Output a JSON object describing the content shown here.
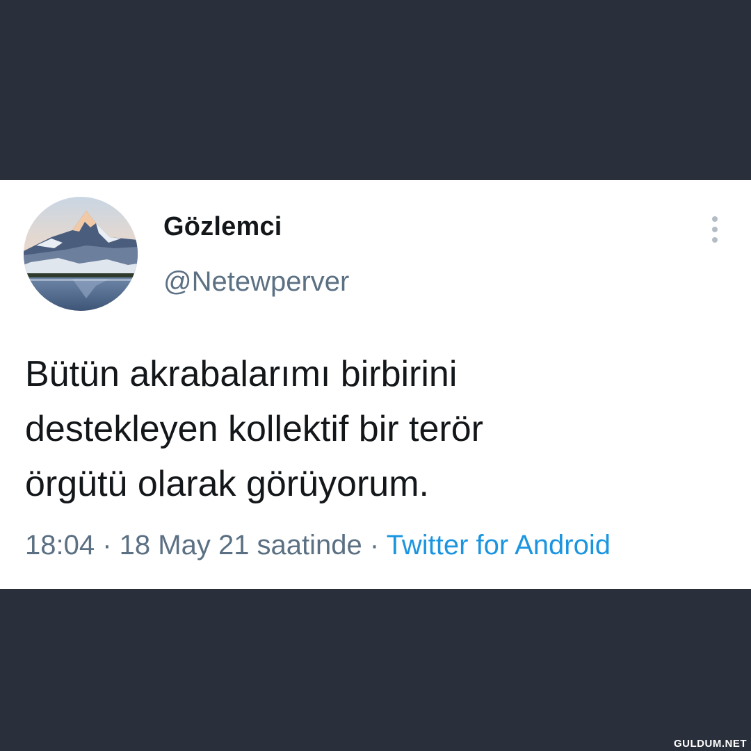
{
  "tweet": {
    "display_name": "Gözlemci",
    "handle": "@Netewperver",
    "text": "Bütün akrabalarımı birbirini\ndestekleyen kollektif bir terör\nörgütü olarak görüyorum.",
    "time": "18:04",
    "separator": " · ",
    "date": "18 May 21 saatinde",
    "source": "Twitter for Android",
    "more_icon": "more-vertical-icon",
    "avatar_image": "mountain-lake-photo"
  },
  "watermark": "GULDUM.NET",
  "colors": {
    "background": "#2a2f3c",
    "card": "#ffffff",
    "text_primary": "#14171a",
    "text_secondary": "#5b7083",
    "link": "#1b95e0"
  }
}
